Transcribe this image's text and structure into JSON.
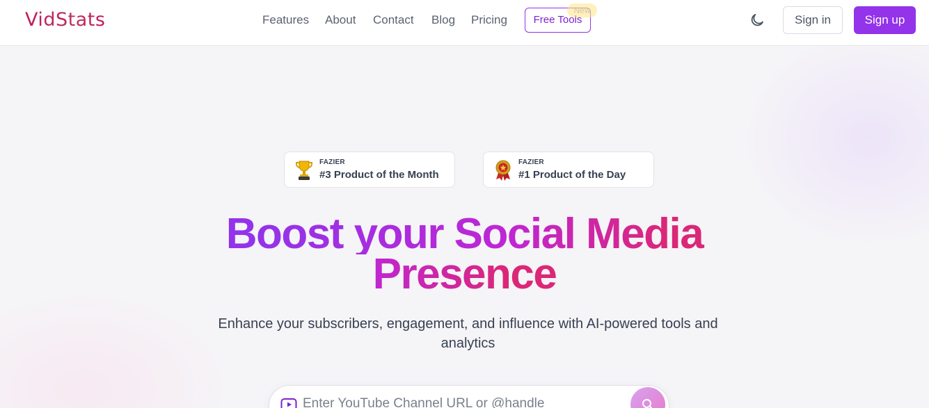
{
  "brand": {
    "logo_text": "VidStats"
  },
  "nav": {
    "items": [
      {
        "label": "Features"
      },
      {
        "label": "About"
      },
      {
        "label": "Contact"
      },
      {
        "label": "Blog"
      },
      {
        "label": "Pricing"
      }
    ],
    "free_tools_label": "Free Tools",
    "new_badge": "New"
  },
  "header_actions": {
    "theme_icon": "moon-icon",
    "signin_label": "Sign in",
    "signup_label": "Sign up"
  },
  "awards": [
    {
      "source": "FAZIER",
      "title": "#3 Product of the Month",
      "icon": "trophy-icon"
    },
    {
      "source": "FAZIER",
      "title": "#1 Product of the Day",
      "icon": "medal-icon"
    }
  ],
  "hero": {
    "title_line1": "Boost your Social Media",
    "title_line2": "Presence",
    "subtitle": "Enhance your subscribers, engagement, and influence with AI-powered tools and analytics"
  },
  "search": {
    "placeholder": "Enter YouTube Channel URL or @handle",
    "value": ""
  },
  "colors": {
    "primary": "#9333ea",
    "accent_pink": "#db2777",
    "logo": "#c2185b"
  }
}
